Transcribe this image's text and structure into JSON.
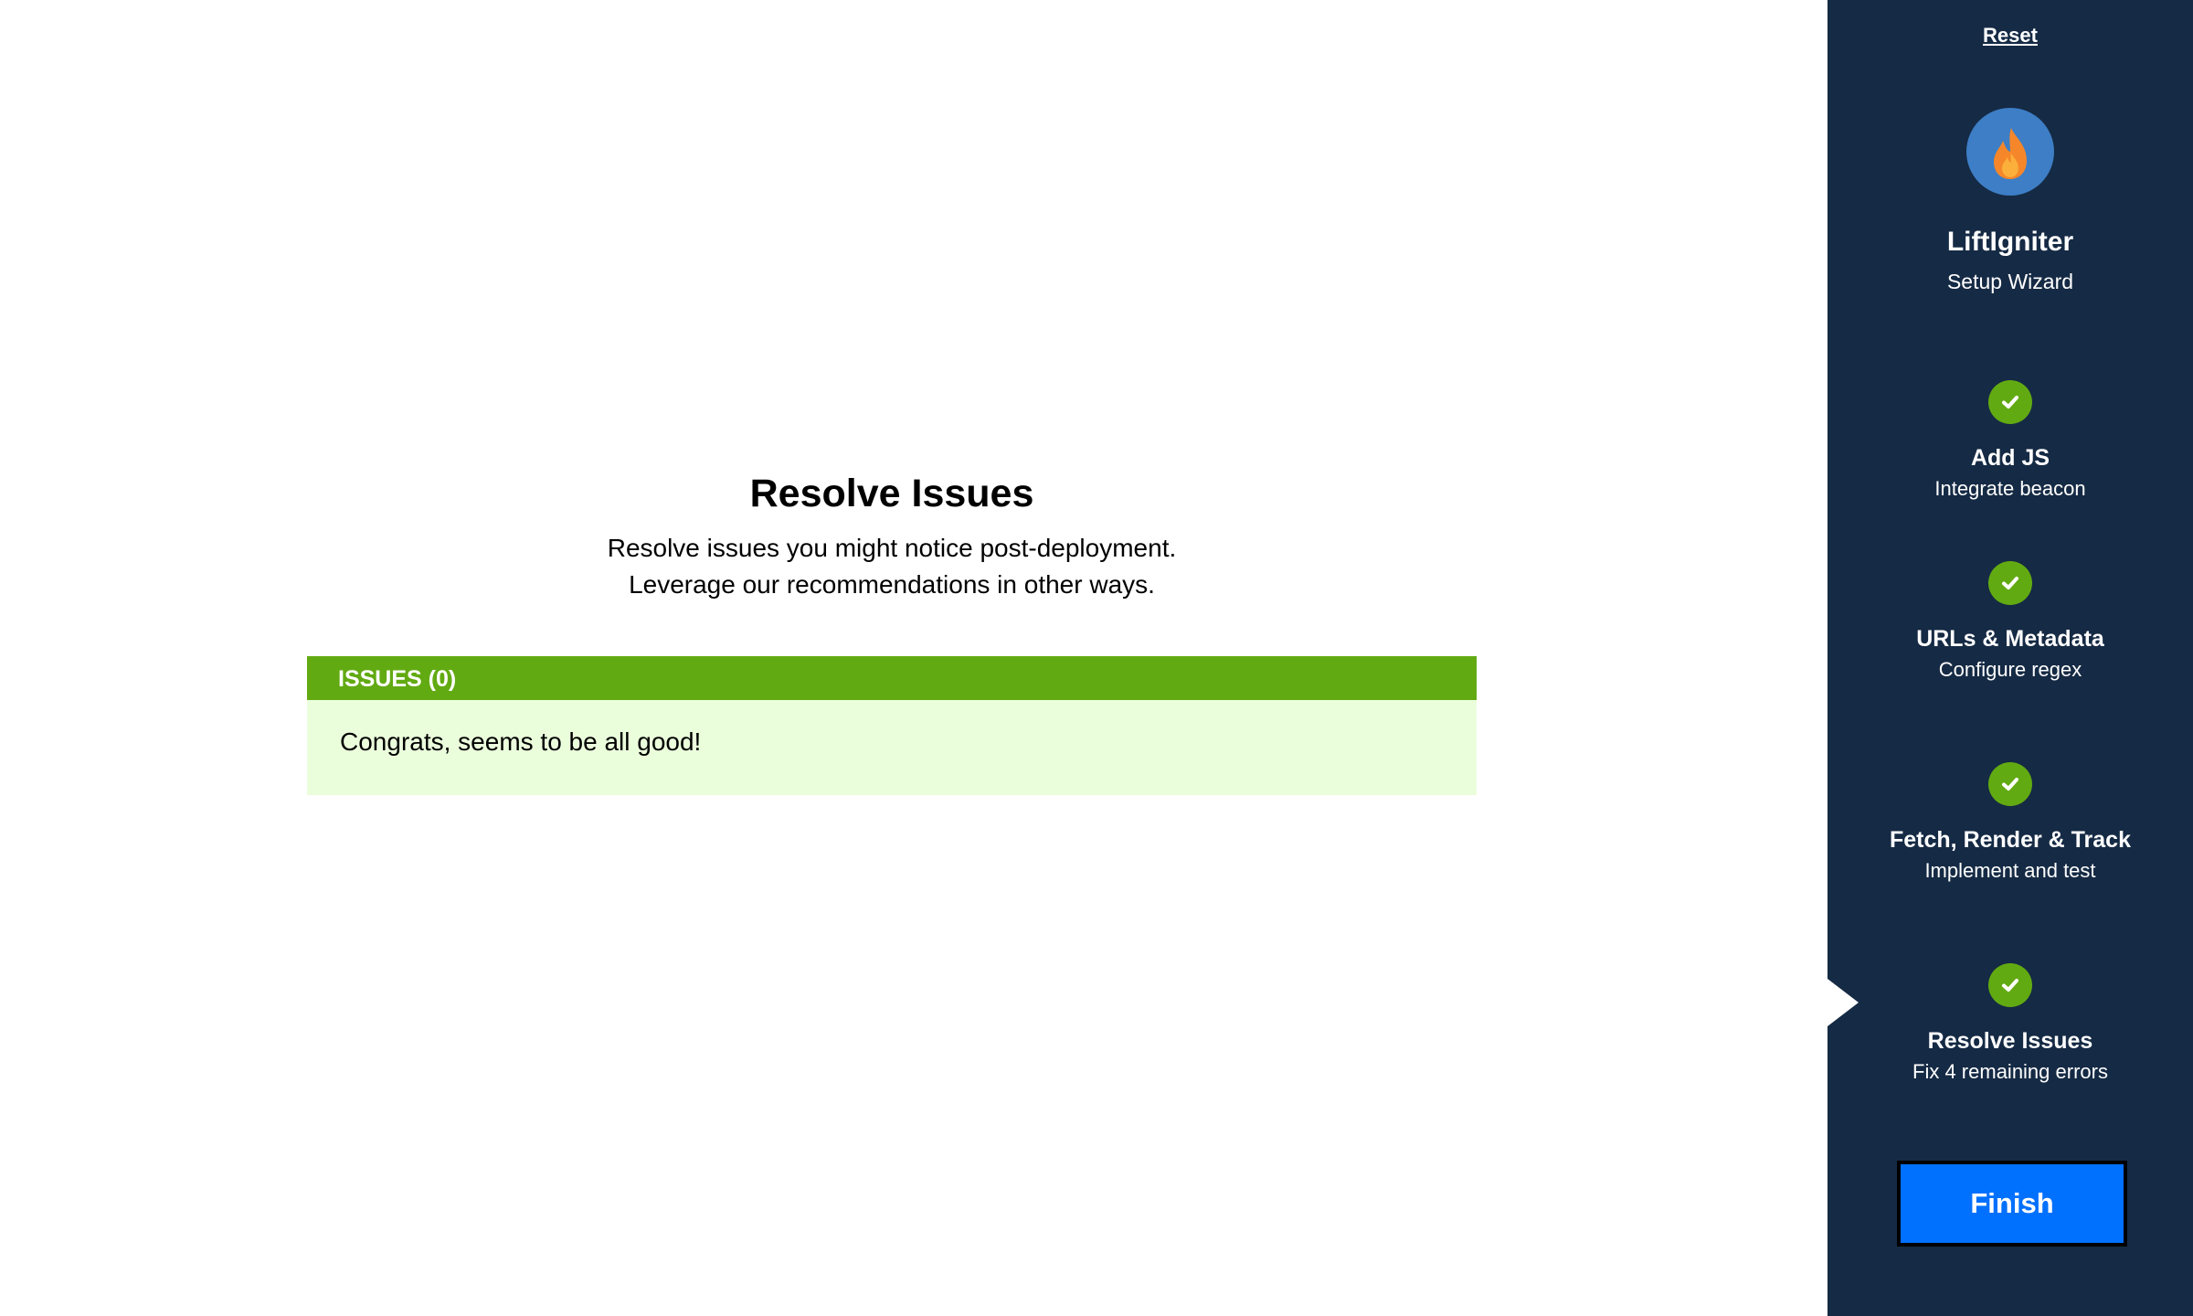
{
  "main": {
    "title": "Resolve Issues",
    "subtitle_lines": [
      "Resolve issues you might notice post-deployment.",
      "Leverage our recommendations in other ways."
    ],
    "issues": {
      "header": "ISSUES (0)",
      "message": "Congrats, seems to be all good!",
      "header_color": "#62aa12",
      "body_color": "#ebfedc"
    }
  },
  "sidebar": {
    "background_color": "#152a44",
    "reset_label": "Reset",
    "brand": {
      "logo_icon": "flame-icon",
      "name": "LiftIgniter",
      "tagline": "Setup Wizard"
    },
    "steps": [
      {
        "title": "Add JS",
        "subtitle": "Integrate beacon",
        "status": "complete",
        "icon": "checkmark-icon"
      },
      {
        "title": "URLs & Metadata",
        "subtitle": "Configure regex",
        "status": "complete",
        "icon": "checkmark-icon"
      },
      {
        "title": "Fetch, Render & Track",
        "subtitle": "Implement and test",
        "status": "complete",
        "icon": "checkmark-icon"
      },
      {
        "title": "Resolve Issues",
        "subtitle": "Fix 4 remaining errors",
        "status": "complete",
        "icon": "checkmark-icon",
        "active": true
      }
    ],
    "finish_label": "Finish",
    "accent_color": "#0070fe",
    "complete_color": "#62aa12"
  }
}
